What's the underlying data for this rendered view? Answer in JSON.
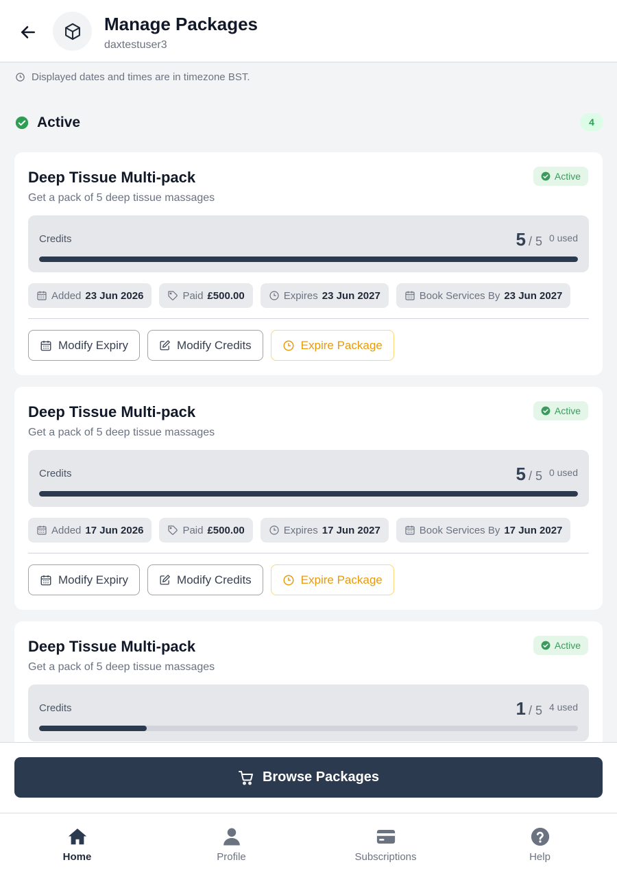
{
  "header": {
    "title": "Manage Packages",
    "subtitle": "daxtestuser3"
  },
  "timezone_note": "Displayed dates and times are in timezone BST.",
  "section": {
    "title": "Active",
    "count": "4"
  },
  "cards": [
    {
      "title": "Deep Tissue Multi-pack",
      "description": "Get a pack of 5 deep tissue massages",
      "status": "Active",
      "credits_label": "Credits",
      "remaining": "5",
      "total": "/ 5",
      "used": "0 used",
      "progress_fraction": 1.0,
      "meta": {
        "added_label": "Added",
        "added_value": "23 Jun 2026",
        "paid_label": "Paid",
        "paid_value": "£500.00",
        "expires_label": "Expires",
        "expires_value": "23 Jun 2027",
        "book_label": "Book Services By",
        "book_value": "23 Jun 2027"
      },
      "actions": {
        "modify_expiry": "Modify Expiry",
        "modify_credits": "Modify Credits",
        "expire_package": "Expire Package"
      }
    },
    {
      "title": "Deep Tissue Multi-pack",
      "description": "Get a pack of 5 deep tissue massages",
      "status": "Active",
      "credits_label": "Credits",
      "remaining": "5",
      "total": "/ 5",
      "used": "0 used",
      "progress_fraction": 1.0,
      "meta": {
        "added_label": "Added",
        "added_value": "17 Jun 2026",
        "paid_label": "Paid",
        "paid_value": "£500.00",
        "expires_label": "Expires",
        "expires_value": "17 Jun 2027",
        "book_label": "Book Services By",
        "book_value": "17 Jun 2027"
      },
      "actions": {
        "modify_expiry": "Modify Expiry",
        "modify_credits": "Modify Credits",
        "expire_package": "Expire Package"
      }
    },
    {
      "title": "Deep Tissue Multi-pack",
      "description": "Get a pack of 5 deep tissue massages",
      "status": "Active",
      "credits_label": "Credits",
      "remaining": "1",
      "total": "/ 5",
      "used": "4 used",
      "progress_fraction": 0.2
    }
  ],
  "browse_button": "Browse Packages",
  "nav": [
    {
      "label": "Home",
      "icon": "home-icon"
    },
    {
      "label": "Profile",
      "icon": "user-icon"
    },
    {
      "label": "Subscriptions",
      "icon": "card-icon"
    },
    {
      "label": "Help",
      "icon": "help-icon"
    }
  ],
  "colors": {
    "primary": "#2b3a4f",
    "success": "#2f9e55",
    "warning": "#e89a0c"
  }
}
